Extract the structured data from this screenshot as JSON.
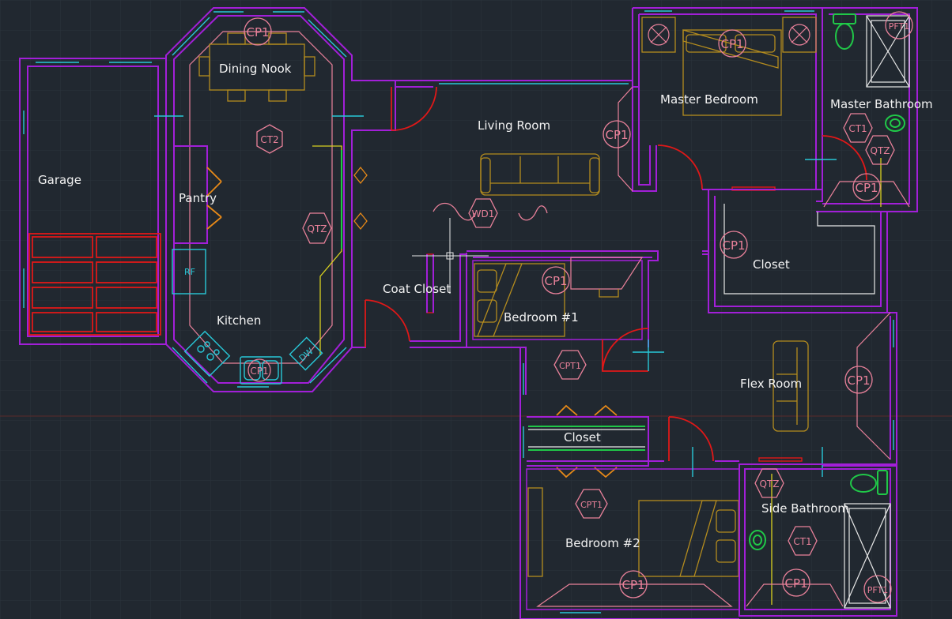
{
  "rooms": {
    "garage": "Garage",
    "dining_nook": "Dining Nook",
    "pantry": "Pantry",
    "kitchen": "Kitchen",
    "living_room": "Living Room",
    "coat_closet": "Coat Closet",
    "bedroom1": "Bedroom #1",
    "closet_mid": "Closet",
    "bedroom2": "Bedroom #2",
    "master_bedroom": "Master Bedroom",
    "master_bathroom": "Master Bathroom",
    "closet_master": "Closet",
    "flex_room": "Flex Room",
    "side_bathroom": "Side Bathroom"
  },
  "tags": {
    "cp1": "CP1",
    "ct1": "CT1",
    "ct2": "CT2",
    "qtz": "QTZ",
    "cpt1": "CPT1",
    "wd1": "WD1",
    "pft1": "PFT1",
    "dw": "DW",
    "rf": "RF"
  },
  "colors": {
    "background": "#212830",
    "walls": "#a21fd8",
    "detail": "#e9819a",
    "furniture": "#b48c1e",
    "windows": "#28c8d8",
    "doors": "#e01818",
    "labels": "#f2f2f2"
  }
}
